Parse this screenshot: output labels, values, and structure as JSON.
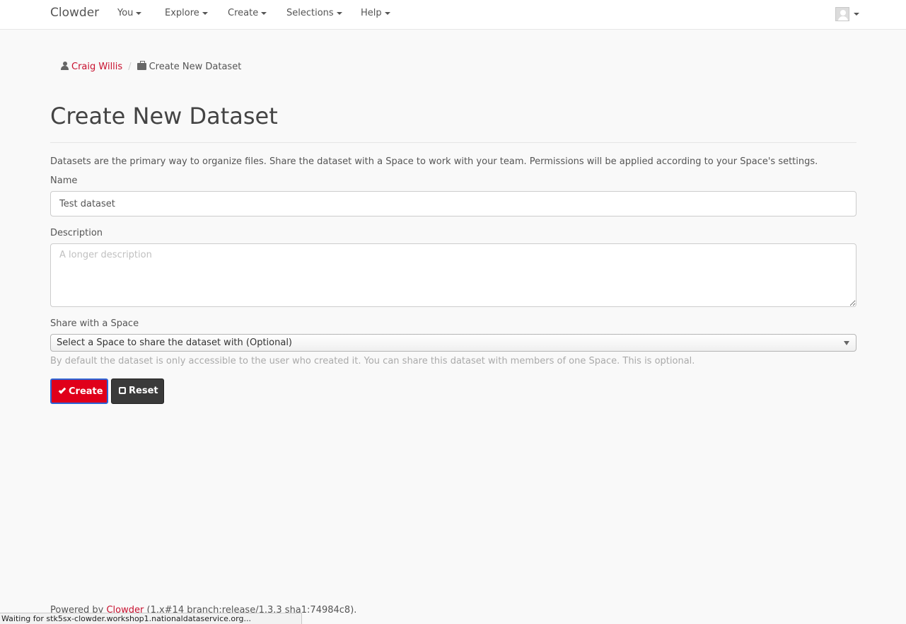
{
  "navbar": {
    "brand": "Clowder",
    "menus": [
      {
        "label": "You"
      },
      {
        "label": "Explore"
      },
      {
        "label": "Create"
      },
      {
        "label": "Selections"
      },
      {
        "label": "Help"
      }
    ]
  },
  "breadcrumb": {
    "user": "Craig Willis",
    "separator": "/",
    "current": "Create New Dataset"
  },
  "page": {
    "title": "Create New Dataset",
    "intro": "Datasets are the primary way to organize files. Share the dataset with a Space to work with your team. Permissions will be applied according to your Space's settings."
  },
  "form": {
    "name_label": "Name",
    "name_value": "Test dataset",
    "description_label": "Description",
    "description_placeholder": "A longer description",
    "space_label": "Share with a Space",
    "space_selected": "Select a Space to share the dataset with (Optional)",
    "space_help": "By default the dataset is only accessible to the user who created it. You can share this dataset with members of one Space. This is optional.",
    "create_label": "Create",
    "reset_label": "Reset"
  },
  "footer": {
    "prefix": "Powered by ",
    "link": "Clowder",
    "suffix": " (1.x#14 branch:release/1.3.3 sha1:74984c8)."
  },
  "status_bar": {
    "text": "Waiting for stk5sx-clowder.workshop1.nationaldataservice.org..."
  },
  "colors": {
    "accent": "#c8102e",
    "create_button": "#e0001a",
    "reset_button": "#3a3a3a"
  }
}
